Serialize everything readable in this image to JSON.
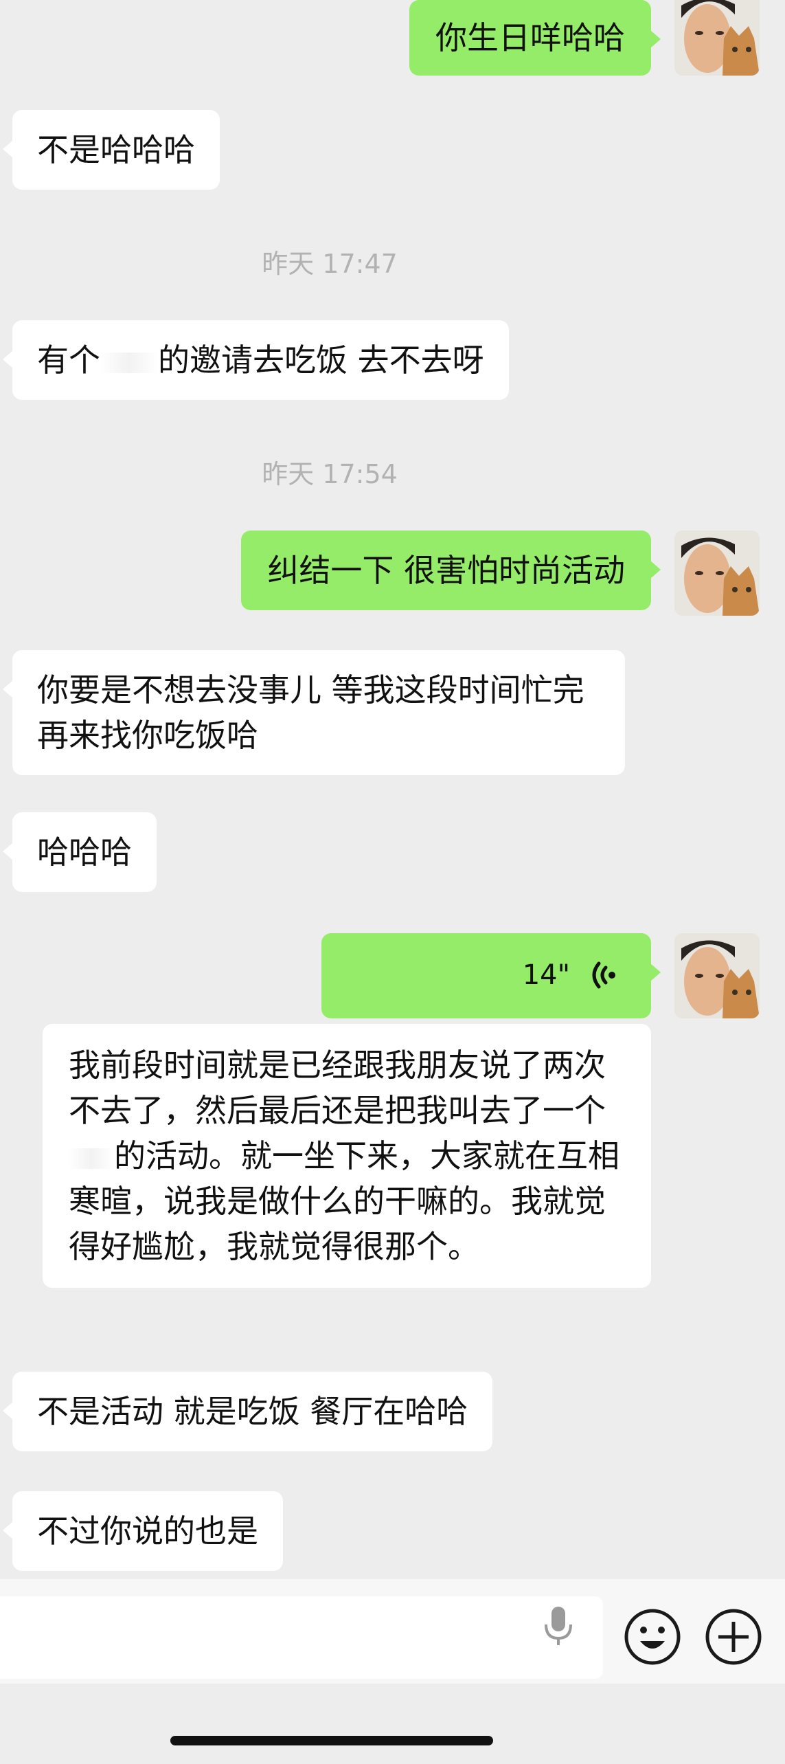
{
  "conversation": {
    "messages": [
      {
        "side": "out",
        "text": "你生日咩哈哈"
      },
      {
        "side": "in",
        "text": "不是哈哈哈"
      },
      {
        "side": "time",
        "text": "昨天 17:47"
      },
      {
        "side": "in",
        "text_before": "有个",
        "text_after": "的邀请去吃饭 去不去呀"
      },
      {
        "side": "time",
        "text": "昨天 17:54"
      },
      {
        "side": "out",
        "text": "纠结一下 很害怕时尚活动"
      },
      {
        "side": "in",
        "text": "你要是不想去没事儿 等我这段时间忙完 再来找你吃饭哈"
      },
      {
        "side": "in",
        "text": "哈哈哈"
      },
      {
        "side": "out",
        "type": "voice",
        "duration": "14\"",
        "transcript_before": "我前段时间就是已经跟我朋友说了两次不去了，然后最后还是把我叫去了一个",
        "transcript_after": "的活动。就一坐下来，大家就在互相寒暄，说我是做什么的干嘛的。我就觉得好尴尬，我就觉得很那个。"
      },
      {
        "side": "in",
        "text": "不是活动 就是吃饭 餐厅在哈哈"
      },
      {
        "side": "in",
        "text": "不过你说的也是"
      }
    ]
  },
  "icons": {
    "voice_wave": "voice-wave-icon",
    "microphone": "microphone-icon",
    "emoji": "emoji-icon",
    "plus": "plus-icon"
  },
  "colors": {
    "background": "#ededed",
    "outgoing_bubble": "#95ec69",
    "incoming_bubble": "#ffffff",
    "timestamp_text": "#b2b2b2"
  }
}
